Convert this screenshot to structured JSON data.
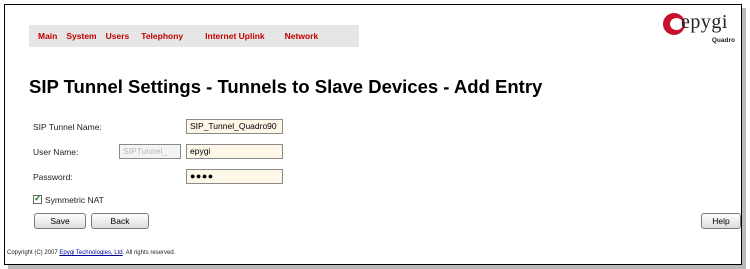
{
  "nav": {
    "items": [
      "Main",
      "System",
      "Users",
      "Telephony",
      "Internet Uplink",
      "Network"
    ]
  },
  "logo": {
    "brand": "epygi",
    "sub": "Quadro"
  },
  "page": {
    "title": "SIP Tunnel Settings - Tunnels to Slave Devices - Add Entry"
  },
  "form": {
    "tunnel_name_label": "SIP Tunnel Name:",
    "tunnel_name_value": "SIP_Tunnel_Quadro90",
    "user_name_label": "User Name:",
    "user_name_prefix": "SIPTunnel_",
    "user_name_value": "epygi",
    "password_label": "Password:",
    "password_value": "●●●●",
    "symmetric_nat_label": "Symmetric NAT",
    "symmetric_nat_checked": true
  },
  "buttons": {
    "save": "Save",
    "back": "Back",
    "help": "Help"
  },
  "footer": {
    "prefix": "Copyright (C) 2007 ",
    "company": "Epygi Technologies, Ltd",
    "suffix": ". All rights reserved."
  },
  "colors": {
    "nav_text": "#c00000",
    "nav_bg": "#e6e6e6",
    "input_bg": "#fdf7e7",
    "brand_red": "#c8102e"
  }
}
